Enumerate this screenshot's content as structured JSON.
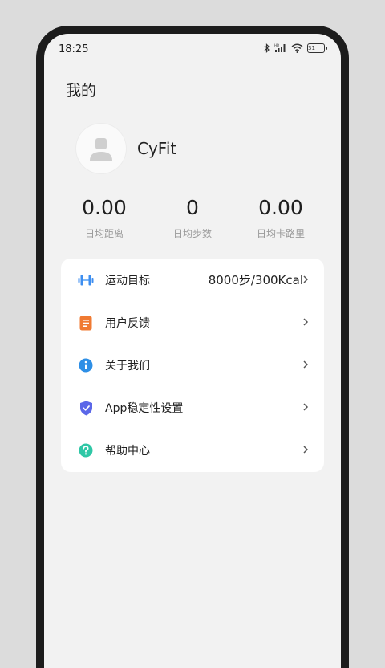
{
  "status_bar": {
    "time": "18:25",
    "battery": "31"
  },
  "page": {
    "title": "我的"
  },
  "profile": {
    "name": "CyFit"
  },
  "stats": [
    {
      "value": "0.00",
      "label": "日均距离"
    },
    {
      "value": "0",
      "label": "日均步数"
    },
    {
      "value": "0.00",
      "label": "日均卡路里"
    }
  ],
  "menu": [
    {
      "label": "运动目标",
      "value": "8000步/300Kcal",
      "icon": "dumbbell-icon",
      "color": "#3d8ef0"
    },
    {
      "label": "用户反馈",
      "icon": "note-icon",
      "color": "#f07a32"
    },
    {
      "label": "关于我们",
      "icon": "info-icon",
      "color": "#2e8fe6"
    },
    {
      "label": "App稳定性设置",
      "icon": "shield-icon",
      "color": "#5b67e8"
    },
    {
      "label": "帮助中心",
      "icon": "help-icon",
      "color": "#2fc7a6"
    }
  ]
}
